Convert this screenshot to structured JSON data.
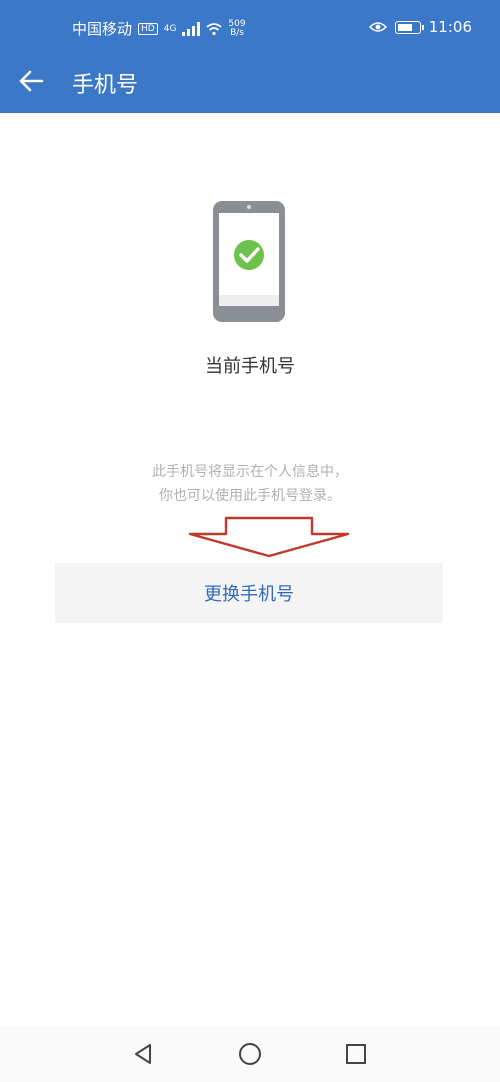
{
  "status_bar": {
    "carrier": "中国移动",
    "network_badge": "4G",
    "net_speed_value": "509",
    "net_speed_unit": "B/s",
    "time": "11:06"
  },
  "header": {
    "title": "手机号"
  },
  "main": {
    "current_label": "当前手机号",
    "info_line1": "此手机号将显示在个人信息中，",
    "info_line2": "你也可以使用此手机号登录。",
    "change_button_label": "更换手机号"
  },
  "colors": {
    "header_bg": "#3c78c8",
    "check_green": "#6cc24a",
    "button_text": "#2f6bbb",
    "annotation_red": "#c0392b"
  },
  "icons": {
    "back": "arrow-left-icon",
    "phone": "phone-check-icon",
    "nav_back": "triangle-back-icon",
    "nav_home": "circle-home-icon",
    "nav_recent": "square-recent-icon"
  }
}
